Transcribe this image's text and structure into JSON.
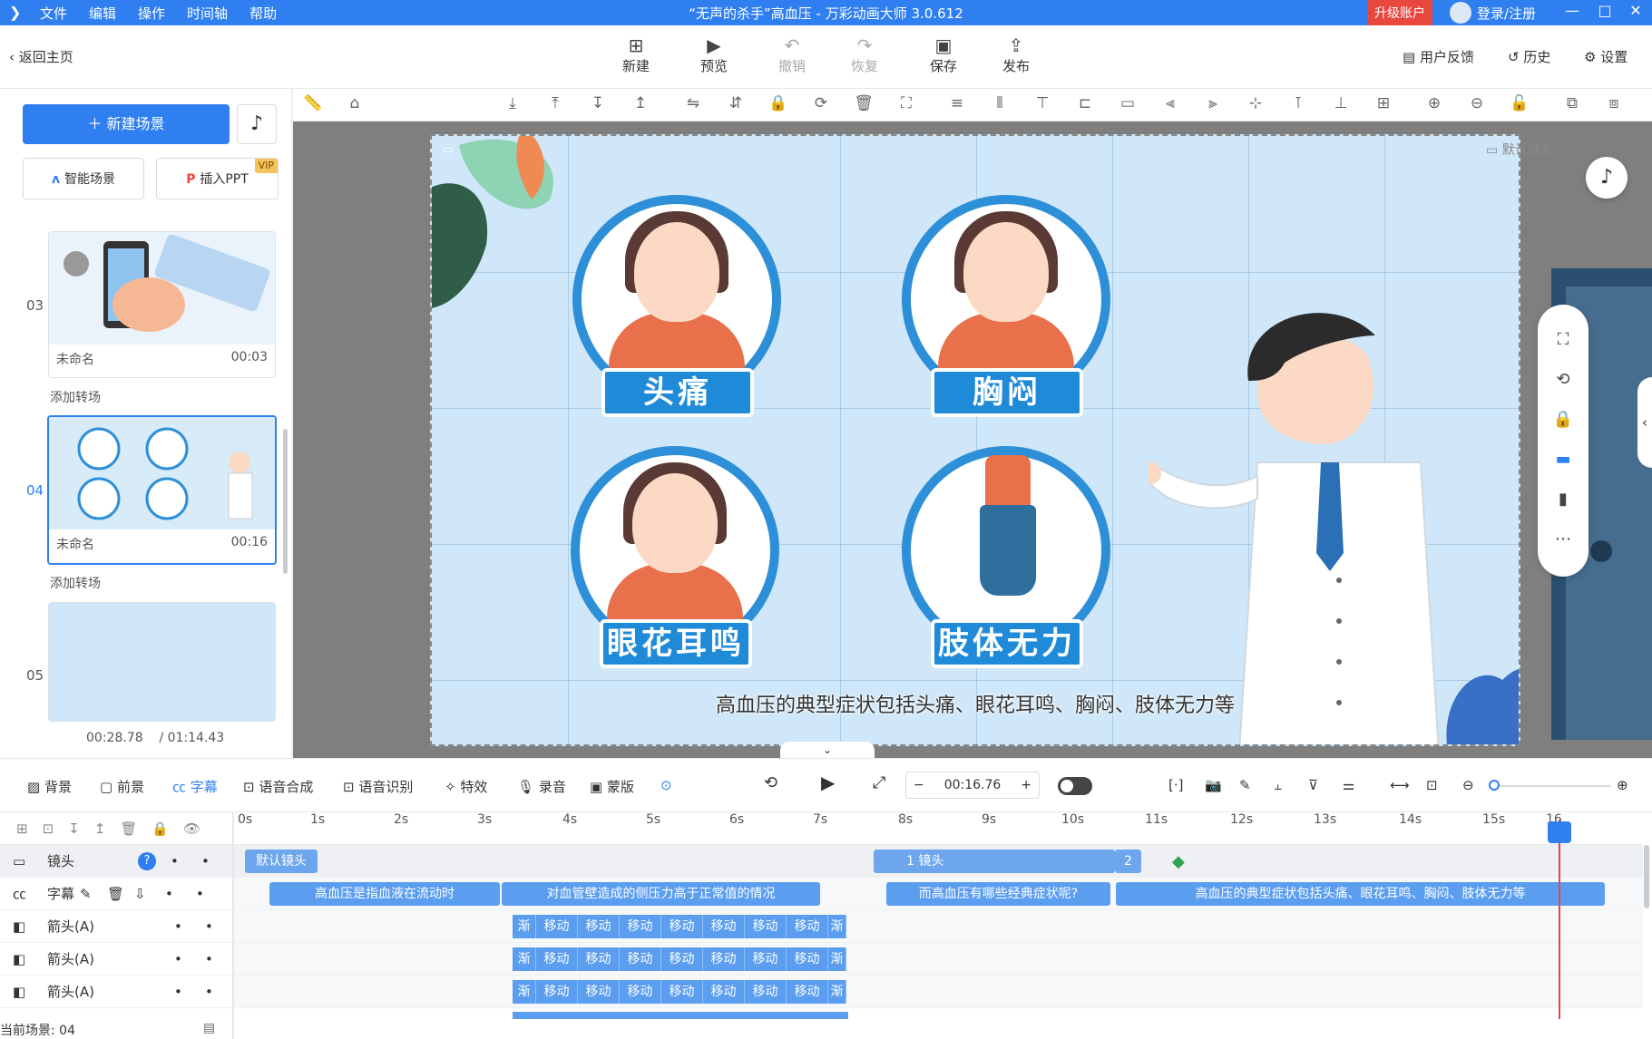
{
  "window": {
    "title": "“无声的杀手”高血压 - 万彩动画大师 3.0.612",
    "menu": [
      "文件",
      "编辑",
      "操作",
      "时间轴",
      "帮助"
    ],
    "upgrade": "升级账户",
    "login": "登录/注册"
  },
  "toolbar": {
    "back": "返回主页",
    "actions": [
      {
        "label": "新建",
        "icon": "plus-box-icon"
      },
      {
        "label": "预览",
        "icon": "play-icon"
      },
      {
        "label": "撤销",
        "icon": "undo-icon"
      },
      {
        "label": "恢复",
        "icon": "redo-icon"
      },
      {
        "label": "保存",
        "icon": "save-icon"
      },
      {
        "label": "发布",
        "icon": "publish-icon"
      }
    ],
    "right": {
      "feedback": "用户反馈",
      "history": "历史",
      "settings": "设置"
    }
  },
  "left_panel": {
    "new_scene": "新建场景",
    "smart_scene": "智能场景",
    "insert_ppt": "插入PPT",
    "vip": "VIP",
    "scenes": [
      {
        "num": "03",
        "name": "未命名",
        "duration": "00:03"
      },
      {
        "num": "04",
        "name": "未命名",
        "duration": "00:16"
      },
      {
        "num": "05",
        "name": "",
        "duration": ""
      }
    ],
    "add_transition": "添加转场",
    "time_current": "00:28.78",
    "time_total": "/ 01:14.43"
  },
  "stage": {
    "camera_label": "默认镜头",
    "symptoms": [
      "头痛",
      "胸闷",
      "眼花耳鸣",
      "肢体无力"
    ],
    "subtitle": "高血压的典型症状包括头痛、眼花耳鸣、胸闷、肢体无力等"
  },
  "bottom_toolbar": {
    "items": [
      "背景",
      "前景",
      "字幕",
      "语音合成",
      "语音识别",
      "特效",
      "录音",
      "蒙版"
    ],
    "time": "00:16.76"
  },
  "timeline": {
    "ticks": [
      "0s",
      "1s",
      "2s",
      "3s",
      "4s",
      "5s",
      "6s",
      "7s",
      "8s",
      "9s",
      "10s",
      "11s",
      "12s",
      "13s",
      "14s",
      "15s",
      "16"
    ],
    "tracks": [
      {
        "name": "镜头",
        "clips": [
          "默认镜头",
          "1 镜头",
          "2"
        ]
      },
      {
        "name": "字幕",
        "clips": [
          "高血压是指血液在流动时",
          "对血管壁造成的侧压力高于正常值的情况",
          "而高血压有哪些经典症状呢?",
          "高血压的典型症状包括头痛、眼花耳鸣、胸闷、肢体无力等"
        ]
      },
      {
        "name": "箭头(A)",
        "clips": [
          "渐",
          "移动",
          "移动",
          "移动",
          "移动",
          "移动",
          "移动",
          "移动",
          "渐"
        ]
      },
      {
        "name": "箭头(A)",
        "clips": [
          "渐",
          "移动",
          "移动",
          "移动",
          "移动",
          "移动",
          "移动",
          "移动",
          "渐"
        ]
      },
      {
        "name": "箭头(A)",
        "clips": [
          "渐",
          "移动",
          "移动",
          "移动",
          "移动",
          "移动",
          "移动",
          "移动",
          "渐"
        ]
      }
    ],
    "status": "当前场景: 04"
  }
}
